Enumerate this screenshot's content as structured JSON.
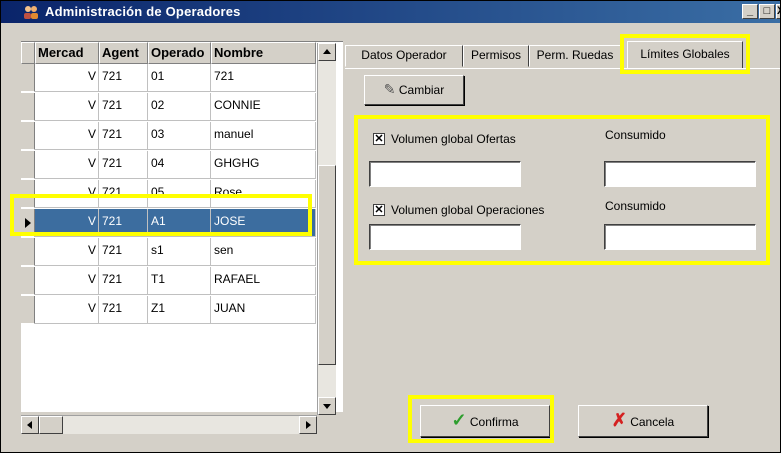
{
  "window": {
    "title": "Administración de Operadores",
    "icon": "users-icon",
    "controls": {
      "minimize": "_",
      "maximize": "□",
      "close": "X"
    }
  },
  "grid": {
    "columns": [
      "Mercad",
      "Agent",
      "Operado",
      "Nombre"
    ],
    "rows": [
      {
        "mercado": "V",
        "agente": "721",
        "operador": "01",
        "nombre": "721"
      },
      {
        "mercado": "V",
        "agente": "721",
        "operador": "02",
        "nombre": "CONNIE"
      },
      {
        "mercado": "V",
        "agente": "721",
        "operador": "03",
        "nombre": "manuel"
      },
      {
        "mercado": "V",
        "agente": "721",
        "operador": "04",
        "nombre": "GHGHG"
      },
      {
        "mercado": "V",
        "agente": "721",
        "operador": "05",
        "nombre": "Rose"
      },
      {
        "mercado": "V",
        "agente": "721",
        "operador": "A1",
        "nombre": "JOSE",
        "selected": true
      },
      {
        "mercado": "V",
        "agente": "721",
        "operador": "s1",
        "nombre": "sen"
      },
      {
        "mercado": "V",
        "agente": "721",
        "operador": "T1",
        "nombre": "RAFAEL"
      },
      {
        "mercado": "V",
        "agente": "721",
        "operador": "Z1",
        "nombre": "JUAN"
      }
    ],
    "selected_color": "#3c6d9f"
  },
  "tabs": [
    {
      "label": "Datos Operador"
    },
    {
      "label": "Permisos"
    },
    {
      "label": "Perm. Ruedas"
    },
    {
      "label": "Límites Globales",
      "active": true
    }
  ],
  "limits": {
    "change_button": "Cambiar",
    "vol_ofertas_label": "Volumen global Ofertas",
    "vol_ofertas_checked": true,
    "consumido_1": "Consumido",
    "vol_operaciones_label": "Volumen global Operaciones",
    "vol_operaciones_checked": true,
    "consumido_2": "Consumido",
    "vol_ofertas_value": "",
    "consumido_ofertas_value": "",
    "vol_operaciones_value": "",
    "consumido_operaciones_value": ""
  },
  "footer": {
    "confirm": "Confirma",
    "cancel": "Cancela"
  },
  "highlight_color": "#ffff00"
}
